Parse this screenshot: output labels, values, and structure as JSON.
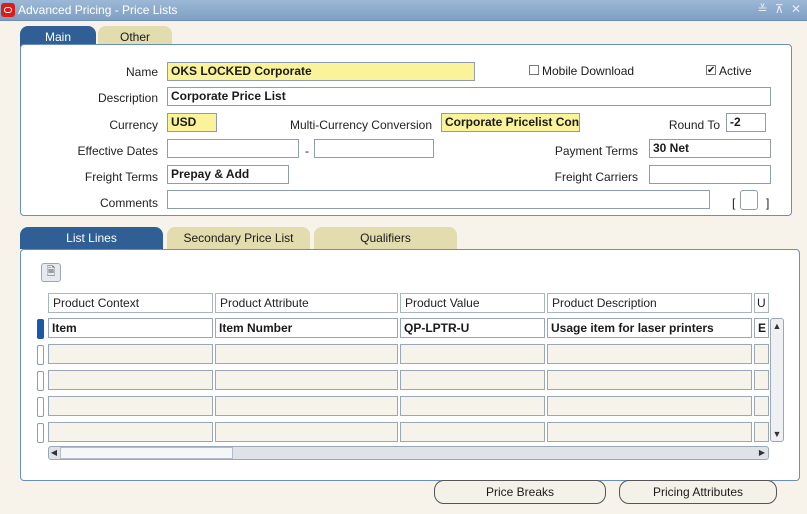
{
  "window": {
    "title": "Advanced Pricing - Price Lists",
    "controls": "≚ ⊼ ✕"
  },
  "top_tabs": [
    {
      "label": "Main"
    },
    {
      "label": "Other"
    }
  ],
  "form": {
    "name_label": "Name",
    "name_value": "OKS LOCKED Corporate",
    "mobile_download_label": "Mobile Download",
    "mobile_download_checked": false,
    "active_label": "Active",
    "active_checked": true,
    "description_label": "Description",
    "description_value": "Corporate Price List",
    "currency_label": "Currency",
    "currency_value": "USD",
    "multi_currency_label": "Multi-Currency Conversion",
    "multi_currency_value": "Corporate Pricelist Conv",
    "round_to_label": "Round To",
    "round_to_value": "-2",
    "effective_dates_label": "Effective Dates",
    "effective_from": "",
    "date_separator": "-",
    "effective_to": "",
    "payment_terms_label": "Payment Terms",
    "payment_terms_value": "30 Net",
    "freight_terms_label": "Freight Terms",
    "freight_terms_value": "Prepay & Add",
    "freight_carriers_label": "Freight Carriers",
    "freight_carriers_value": "",
    "comments_label": "Comments",
    "comments_value": "",
    "flex_open": "[",
    "flex_close": "]"
  },
  "bottom_tabs": [
    {
      "label": "List Lines"
    },
    {
      "label": "Secondary Price List"
    },
    {
      "label": "Qualifiers"
    }
  ],
  "grid": {
    "columns": [
      "Product Context",
      "Product Attribute",
      "Product Value",
      "Product Description",
      "U"
    ],
    "rows": [
      [
        "Item",
        "Item Number",
        "QP-LPTR-U",
        "Usage item for laser printers",
        "E"
      ],
      [
        "",
        "",
        "",
        "",
        ""
      ],
      [
        "",
        "",
        "",
        "",
        ""
      ],
      [
        "",
        "",
        "",
        "",
        ""
      ],
      [
        "",
        "",
        "",
        "",
        ""
      ]
    ]
  },
  "buttons": {
    "price_breaks": "Price Breaks",
    "pricing_attributes": "Pricing Attributes"
  },
  "colors": {
    "tab_active": "#2f5f95",
    "tab_inactive": "#e2dcae",
    "required_field": "#fbf39a",
    "titlebar": "#8aaacd"
  }
}
